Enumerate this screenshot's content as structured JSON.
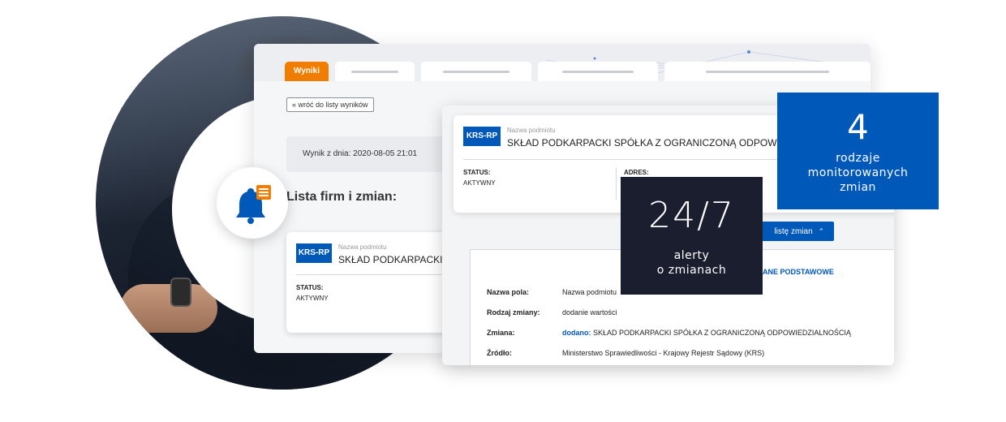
{
  "tabs": {
    "active_label": "Wyniki"
  },
  "results": {
    "back_link": "« wróć do listy wyników",
    "result_date": "Wynik z dnia: 2020-08-05 21:01",
    "list_title": "Lista firm i zmian:"
  },
  "firm_card": {
    "badge": "KRS-RP",
    "name_label": "Nazwa podmiotu",
    "name": "SKŁAD PODKARPACKI S",
    "status_label": "STATUS:",
    "status_value": "AKTYWNY"
  },
  "detail": {
    "badge": "KRS-RP",
    "name_label": "Nazwa podmiotu",
    "name": "SKŁAD PODKARPACKI SPÓŁKA Z OGRANICZONĄ ODPOWIEDZ",
    "status_label": "STATUS:",
    "status_value": "AKTYWNY",
    "address_label": "ADRES:",
    "changes_button": "listę zmian",
    "section_link": "ANE PODSTAWOWE",
    "rows": [
      {
        "label": "Nazwa pola:",
        "value": "Nazwa podmiotu"
      },
      {
        "label": "Rodzaj zmiany:",
        "value": "dodanie wartości"
      },
      {
        "label": "Zmiana:",
        "highlight": "dodano:",
        "value": " SKŁAD PODKARPACKI SPÓŁKA Z OGRANICZONĄ ODPOWIEDZIALNOŚCIĄ"
      },
      {
        "label": "Źródło:",
        "value": "Ministerstwo Sprawiedliwości - Krajowy Rejestr Sądowy (KRS)"
      }
    ]
  },
  "stats": {
    "alerts_big": "24/7",
    "alerts_line1": "alerty",
    "alerts_line2": "o zmianach",
    "types_big": "4",
    "types_line1": "rodzaje",
    "types_line2": "monitorowanych",
    "types_line3": "zmian"
  },
  "colors": {
    "brand_blue": "#0058b8",
    "accent_orange": "#f07c00",
    "dark_navy": "#1b1e2e"
  },
  "icons": {
    "notification": "bell-icon",
    "list": "list-icon",
    "chevron": "chevron-up-icon"
  }
}
